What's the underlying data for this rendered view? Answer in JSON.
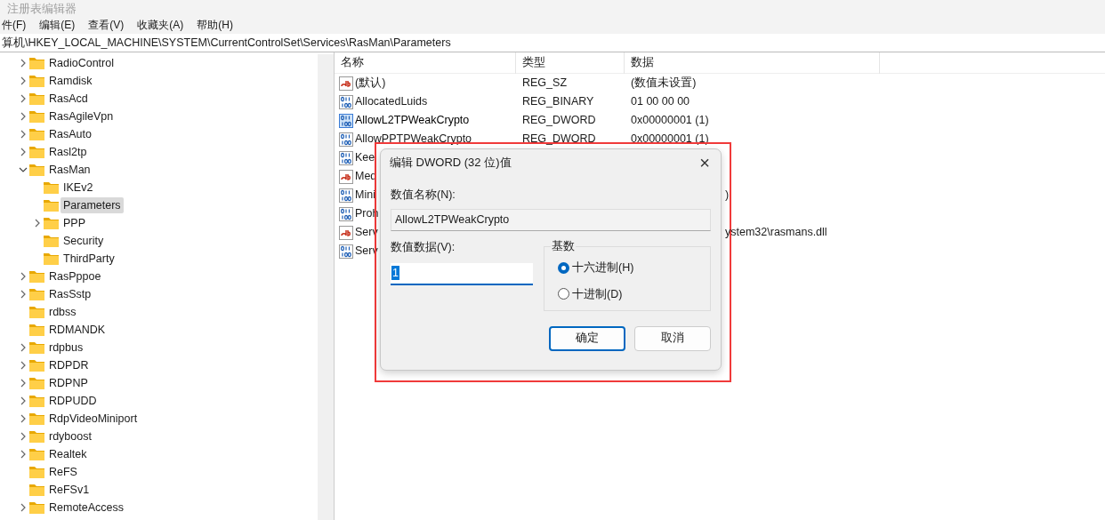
{
  "window": {
    "title": "注册表编辑器"
  },
  "menu": [
    "件(F)",
    "编辑(E)",
    "查看(V)",
    "收藏夹(A)",
    "帮助(H)"
  ],
  "address": "算机\\HKEY_LOCAL_MACHINE\\SYSTEM\\CurrentControlSet\\Services\\RasMan\\Parameters",
  "tree": [
    {
      "label": "RadioControl",
      "expanded": false,
      "selected": false
    },
    {
      "label": "Ramdisk",
      "expanded": false,
      "selected": false
    },
    {
      "label": "RasAcd",
      "expanded": false,
      "selected": false
    },
    {
      "label": "RasAgileVpn",
      "expanded": false,
      "selected": false
    },
    {
      "label": "RasAuto",
      "expanded": false,
      "selected": false
    },
    {
      "label": "Rasl2tp",
      "expanded": false,
      "selected": false
    },
    {
      "label": "RasMan",
      "expanded": true,
      "selected": false,
      "children": [
        {
          "label": "IKEv2",
          "selected": false
        },
        {
          "label": "Parameters",
          "selected": true
        },
        {
          "label": "PPP",
          "expanded": false,
          "selected": false
        },
        {
          "label": "Security",
          "selected": false
        },
        {
          "label": "ThirdParty",
          "selected": false
        }
      ]
    },
    {
      "label": "RasPppoe",
      "expanded": false,
      "selected": false
    },
    {
      "label": "RasSstp",
      "expanded": false,
      "selected": false
    },
    {
      "label": "rdbss",
      "selected": false
    },
    {
      "label": "RDMANDK",
      "selected": false
    },
    {
      "label": "rdpbus",
      "expanded": false,
      "selected": false
    },
    {
      "label": "RDPDR",
      "expanded": false,
      "selected": false
    },
    {
      "label": "RDPNP",
      "expanded": false,
      "selected": false
    },
    {
      "label": "RDPUDD",
      "expanded": false,
      "selected": false
    },
    {
      "label": "RdpVideoMiniport",
      "expanded": false,
      "selected": false
    },
    {
      "label": "rdyboost",
      "expanded": false,
      "selected": false
    },
    {
      "label": "Realtek",
      "expanded": false,
      "selected": false
    },
    {
      "label": "ReFS",
      "selected": false
    },
    {
      "label": "ReFSv1",
      "selected": false
    },
    {
      "label": "RemoteAccess",
      "expanded": false,
      "selected": false
    }
  ],
  "table": {
    "columns": [
      "名称",
      "类型",
      "数据"
    ],
    "rows": [
      {
        "kind": "string",
        "name": "(默认)",
        "type": "REG_SZ",
        "data": "(数值未设置)",
        "selected": false
      },
      {
        "kind": "binary",
        "name": "AllocatedLuids",
        "type": "REG_BINARY",
        "data": "01 00 00 00",
        "selected": false
      },
      {
        "kind": "binary",
        "name": "AllowL2TPWeakCrypto",
        "type": "REG_DWORD",
        "data": "0x00000001 (1)",
        "selected": true
      },
      {
        "kind": "binary",
        "name": "AllowPPTPWeakCrypto",
        "type": "REG_DWORD",
        "data": "0x00000001 (1)",
        "selected": false
      },
      {
        "kind": "binary",
        "name": "Kee",
        "selected": false
      },
      {
        "kind": "string",
        "name": "Med",
        "selected": false
      },
      {
        "kind": "binary",
        "name": "Mini",
        "data_tail": ")",
        "selected": false
      },
      {
        "kind": "binary",
        "name": "Proh",
        "selected": false
      },
      {
        "kind": "string",
        "name": "Serv",
        "data_tail": "ystem32\\rasmans.dll",
        "selected": false
      },
      {
        "kind": "binary",
        "name": "Serv",
        "selected": false
      }
    ]
  },
  "dialog": {
    "title": "编辑 DWORD (32 位)值",
    "close": "×",
    "name_label": "数值名称(N):",
    "name_value": "AllowL2TPWeakCrypto",
    "data_label": "数值数据(V):",
    "data_value": "1",
    "base_label": "基数",
    "bases": [
      {
        "label": "十六进制(H)",
        "selected": true
      },
      {
        "label": "十进制(D)",
        "selected": false
      }
    ],
    "buttons": [
      {
        "label": "确定",
        "default": true
      },
      {
        "label": "取消",
        "default": false
      }
    ]
  }
}
